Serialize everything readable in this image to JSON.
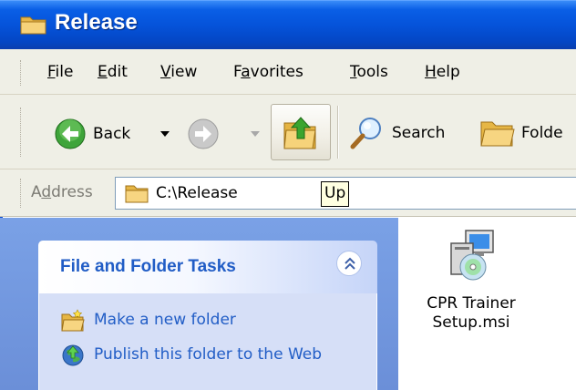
{
  "window": {
    "title": "Release"
  },
  "menu": {
    "file": {
      "accel": "F",
      "rest": "ile"
    },
    "edit": {
      "accel": "E",
      "rest": "dit"
    },
    "view": {
      "accel": "V",
      "rest": "iew"
    },
    "favorites": {
      "pre": "F",
      "accel": "a",
      "rest": "vorites"
    },
    "tools": {
      "accel": "T",
      "rest": "ools"
    },
    "help": {
      "accel": "H",
      "rest": "elp"
    }
  },
  "toolbar": {
    "back_label": "Back",
    "search_label": "Search",
    "folders_label": "Folde",
    "tooltip": "Up"
  },
  "address": {
    "label_pre": "A",
    "label_accel": "d",
    "label_rest": "dress",
    "value": "C:\\Release"
  },
  "tasks": {
    "title": "File and Folder Tasks",
    "items": [
      {
        "label": "Make a new folder",
        "icon": "new-folder-icon"
      },
      {
        "label": "Publish this folder to the Web",
        "icon": "publish-web-icon"
      }
    ]
  },
  "files": [
    {
      "name": "CPR Trainer Setup.msi",
      "icon": "msi-installer-icon"
    }
  ],
  "colors": {
    "titlebar": "#0553da",
    "menubar": "#efefe6",
    "task_pane": "#6b8fd8",
    "task_body": "#d6dff7",
    "task_text": "#215dc6",
    "tooltip_bg": "#ffffe1"
  }
}
